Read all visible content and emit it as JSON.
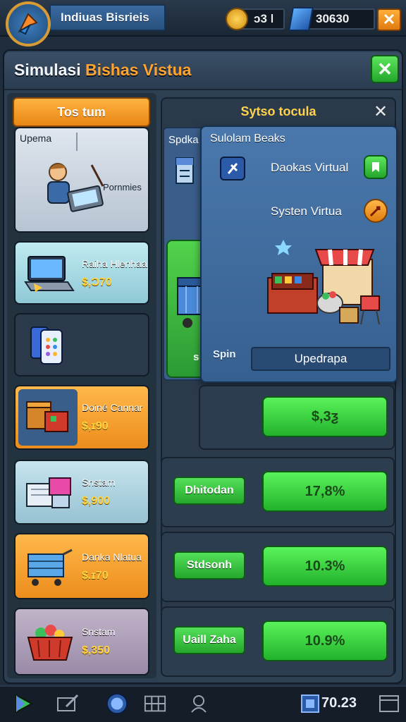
{
  "topbar": {
    "title": "Indiuas Bisrieis",
    "coins": "ↄ3 ǀ",
    "gems": "30630",
    "close": "✕"
  },
  "header": {
    "title_white": "Simulasi ",
    "title_orange": "Bishas Vistua",
    "close": "✕"
  },
  "sidebar": {
    "tab": "Tos tum",
    "cards": [
      {
        "label": "Upema",
        "caption": "Pornmies",
        "price": ""
      },
      {
        "label": "Raiha Hlenhaa",
        "price": "$,Ɔ70"
      },
      {
        "label": "",
        "price": ""
      },
      {
        "label": "Doiné Cannar",
        "price": "$,ɪ90"
      },
      {
        "label": "Snstam",
        "price": "$,900"
      },
      {
        "label": "Danka Nlatua",
        "price": "$.ɪ70"
      },
      {
        "label": "Snstam",
        "price": "$,350"
      }
    ]
  },
  "right": {
    "heading": "Sytso tocula",
    "close": "✕",
    "sub_label": "Spdka",
    "popup": {
      "title": "Sulolam Beaks",
      "row1": "Daokas Virtual",
      "row2": "Systen Virtua",
      "upgrade": "Upedrapa"
    },
    "green_item": "Spin",
    "green_item_prefix": "s",
    "rows": [
      {
        "small": "",
        "big": "$,3ƺ"
      },
      {
        "small": "Dhitodan",
        "big": "17,8%"
      },
      {
        "small": "Stdsonh",
        "big": "10.3%"
      },
      {
        "small": "Uaill Zaha",
        "big": "10.9%"
      }
    ]
  },
  "bottombar": {
    "value": "70.23"
  },
  "colors": {
    "accent_orange": "#ffa22e",
    "accent_green": "#3ccf45",
    "panel": "#2d3f52"
  }
}
